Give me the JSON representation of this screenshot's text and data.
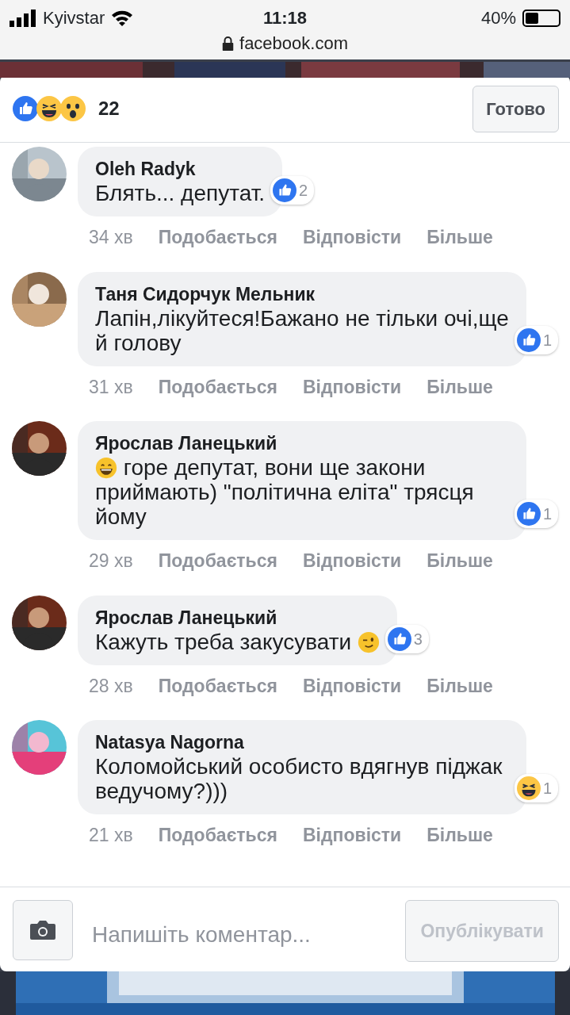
{
  "status_bar": {
    "carrier": "Kyivstar",
    "time": "11:18",
    "url": "facebook.com",
    "battery": "40%"
  },
  "header": {
    "reactions": [
      {
        "kind": "like"
      },
      {
        "kind": "haha"
      },
      {
        "kind": "wow"
      }
    ],
    "count": "22",
    "done_button": "Готово"
  },
  "comments": [
    {
      "author": "Oleh Radyk",
      "text": "Блять... депутат.",
      "reaction": {
        "kind": "like",
        "count": "2"
      },
      "time": "34 хв",
      "actions": [
        "Подобається",
        "Відповісти",
        "Більше"
      ]
    },
    {
      "author": "Таня Сидорчук Мельник",
      "text": "Лапін,лікуйтеся!Бажано не тільки очі,ще й голову",
      "reaction": {
        "kind": "like",
        "count": "1"
      },
      "time": "31 хв",
      "actions": [
        "Подобається",
        "Відповісти",
        "Більше"
      ]
    },
    {
      "author": "Ярослав Ланецький",
      "emoji_start": {
        "kind": "grin"
      },
      "text": "горе депутат, вони ще закони приймають) \"політична еліта\" трясця йому",
      "reaction": {
        "kind": "like",
        "count": "1"
      },
      "time": "29 хв",
      "actions": [
        "Подобається",
        "Відповісти",
        "Більше"
      ]
    },
    {
      "author": "Ярослав Ланецький",
      "text": "Кажуть треба закусувати",
      "emoji_end": {
        "kind": "wink"
      },
      "reaction": {
        "kind": "like",
        "count": "3"
      },
      "time": "28 хв",
      "actions": [
        "Подобається",
        "Відповісти",
        "Більше"
      ]
    },
    {
      "author": "Natasya Nagorna",
      "text": "Коломойський особисто вдягнув піджак ведучому?)))",
      "reaction": {
        "kind": "haha",
        "count": "1"
      },
      "time": "21 хв",
      "actions": [
        "Подобається",
        "Відповісти",
        "Більше"
      ]
    }
  ],
  "composer": {
    "placeholder": "Напишіть коментар...",
    "publish_button": "Опублікувати",
    "disabled": true
  }
}
